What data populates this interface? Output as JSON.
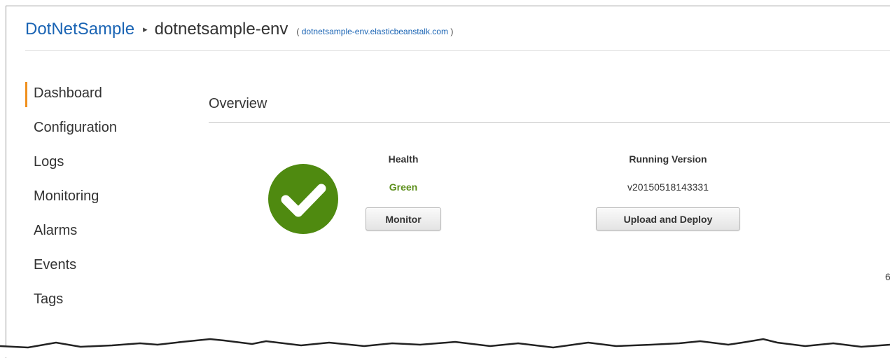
{
  "header": {
    "app_name": "DotNetSample",
    "separator": "▸",
    "env_name": "dotnetsample-env",
    "url_open": "(",
    "env_url": "dotnetsample-env.elasticbeanstalk.com",
    "url_close": ")"
  },
  "sidebar": {
    "items": [
      {
        "label": "Dashboard",
        "active": true
      },
      {
        "label": "Configuration"
      },
      {
        "label": "Logs"
      },
      {
        "label": "Monitoring"
      },
      {
        "label": "Alarms"
      },
      {
        "label": "Events"
      },
      {
        "label": "Tags"
      }
    ]
  },
  "overview": {
    "title": "Overview",
    "health": {
      "label": "Health",
      "value": "Green",
      "value_color": "#5d8f1c",
      "icon": "check-circle-icon",
      "icon_color": "#4f8a10",
      "button": "Monitor"
    },
    "version": {
      "label": "Running Version",
      "value": "v20150518143331",
      "button": "Upload and Deploy"
    },
    "cut_off_text": "6"
  },
  "colors": {
    "link": "#1a64b4",
    "active_indicator": "#f0901e"
  }
}
